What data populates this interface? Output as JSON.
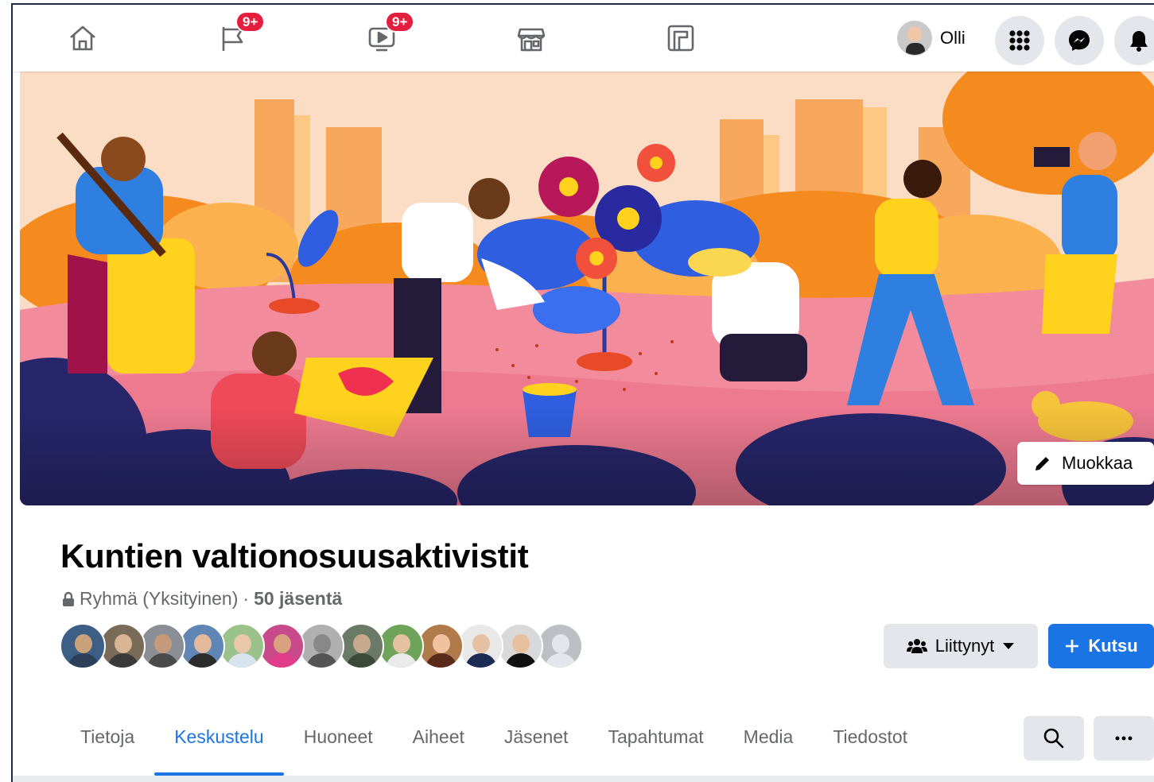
{
  "nav": {
    "items": [
      {
        "name": "home-icon",
        "badge": ""
      },
      {
        "name": "pages-flag-icon",
        "badge": "9+"
      },
      {
        "name": "video-icon",
        "badge": "9+"
      },
      {
        "name": "marketplace-icon",
        "badge": ""
      },
      {
        "name": "gaming-icon",
        "badge": ""
      }
    ],
    "profile_name": "Olli",
    "menu_icon": "grid-menu-icon",
    "messenger_icon": "messenger-icon",
    "notifications_icon": "bell-icon"
  },
  "cover": {
    "edit_label": "Muokkaa"
  },
  "group": {
    "title": "Kuntien valtionosuusaktivistit",
    "privacy": "Ryhmä (Yksityinen)",
    "separator": "·",
    "members": "50 jäsentä",
    "member_faces": 13
  },
  "actions": {
    "joined_label": "Liittynyt",
    "invite_label": "Kutsu"
  },
  "tabs": [
    {
      "label": "Tietoja",
      "active": false
    },
    {
      "label": "Keskustelu",
      "active": true
    },
    {
      "label": "Huoneet",
      "active": false
    },
    {
      "label": "Aiheet",
      "active": false
    },
    {
      "label": "Jäsenet",
      "active": false
    },
    {
      "label": "Tapahtumat",
      "active": false
    },
    {
      "label": "Media",
      "active": false
    },
    {
      "label": "Tiedostot",
      "active": false
    }
  ],
  "colors": {
    "accent": "#1b74e4",
    "badge": "#e41e3f",
    "secondary_button": "#e4e6eb",
    "muted_text": "#65676b"
  }
}
